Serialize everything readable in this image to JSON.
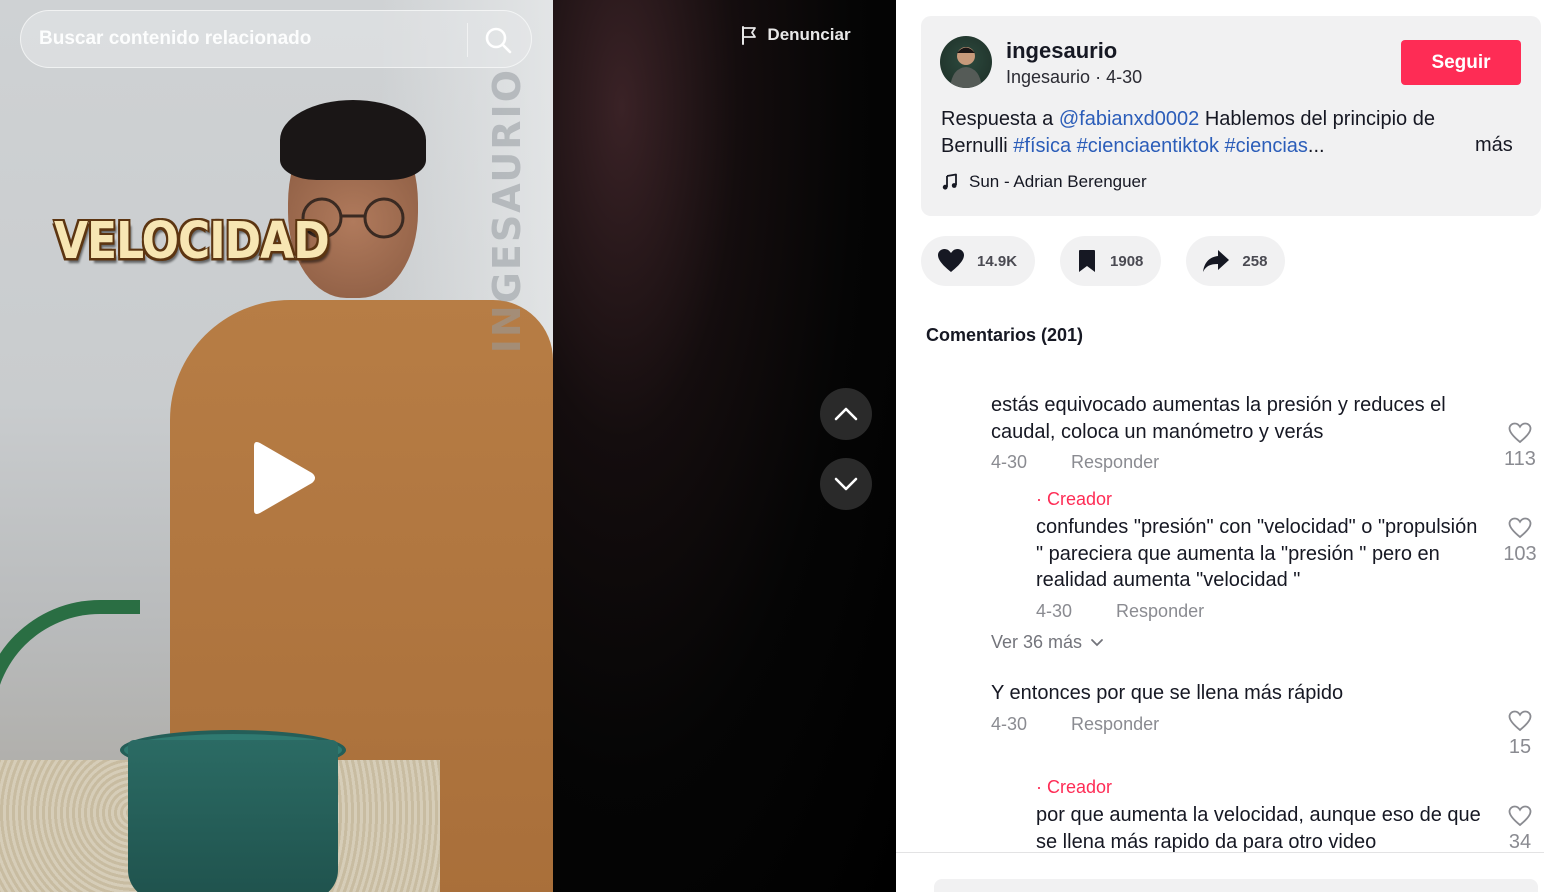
{
  "search": {
    "placeholder": "Buscar contenido relacionado"
  },
  "video": {
    "overlay_text": "VELOCIDAD",
    "watermark": "INGESAURIO"
  },
  "report": {
    "label": "Denunciar"
  },
  "author": {
    "username": "ingesaurio",
    "nickname": "Ingesaurio",
    "date": "4-30",
    "follow_label": "Seguir"
  },
  "description": {
    "prefix": "Respuesta a ",
    "mention": "@fabianxd0002",
    "text": " Hablemos del principio de Bernulli ",
    "hashtags": [
      "#física",
      "#cienciaentiktok",
      "#ciencias"
    ],
    "ellipsis": "...",
    "more_label": "más"
  },
  "music": {
    "title": "Sun - Adrian Berenguer"
  },
  "actions": {
    "likes": "14.9K",
    "saves": "1908",
    "shares": "258"
  },
  "comments_header": "Comentarios (201)",
  "comments": [
    {
      "text": "estás equivocado aumentas la presión y reduces el caudal, coloca un manómetro y verás",
      "date": "4-30",
      "reply_label": "Responder",
      "likes": "113"
    },
    {
      "creator_label": "· Creador",
      "text": "confundes \"presión\" con \"velocidad\" o \"propulsión \" pareciera que aumenta la \"presión \" pero en realidad aumenta \"velocidad \"",
      "date": "4-30",
      "reply_label": "Responder",
      "likes": "103"
    },
    {
      "view_more": "Ver 36 más"
    },
    {
      "text": "Y entonces por que se llena más rápido",
      "date": "4-30",
      "reply_label": "Responder",
      "likes": "15"
    },
    {
      "creator_label": "· Creador",
      "text": "por que aumenta la velocidad, aunque eso de que se llena más rapido da para otro video",
      "likes": "34"
    }
  ],
  "colors": {
    "accent": "#fe2c55",
    "link": "#2b5db9",
    "card_bg": "#f1f1f2"
  }
}
